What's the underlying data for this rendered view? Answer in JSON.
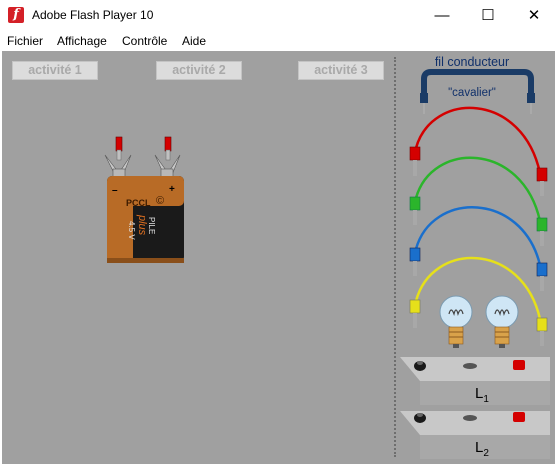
{
  "window": {
    "title": "Adobe Flash Player 10",
    "icon": "flash-player-icon",
    "minimize": "—",
    "maximize": "☐",
    "close": "✕"
  },
  "menu": [
    "Fichier",
    "Affichage",
    "Contrôle",
    "Aide"
  ],
  "tabs": [
    "activité 1",
    "activité 2",
    "activité 3"
  ],
  "battery": {
    "brand": "PCCL",
    "logo": "©",
    "text1": "PILE",
    "text2": "plus",
    "voltage": "4.5 V",
    "minus": "–",
    "plus": "+"
  },
  "palette": {
    "title": "fil conducteur",
    "jumper": "\"cavalier\"",
    "wires": [
      "red",
      "green",
      "blue",
      "yellow"
    ],
    "lamps": [
      {
        "letter": "L",
        "index": "1"
      },
      {
        "letter": "L",
        "index": "2"
      }
    ]
  },
  "colors": {
    "stage": "#a0a0a0",
    "red": "#d40000",
    "green": "#2bb52b",
    "blue": "#1a6fcc",
    "yellow": "#e6e01a"
  }
}
